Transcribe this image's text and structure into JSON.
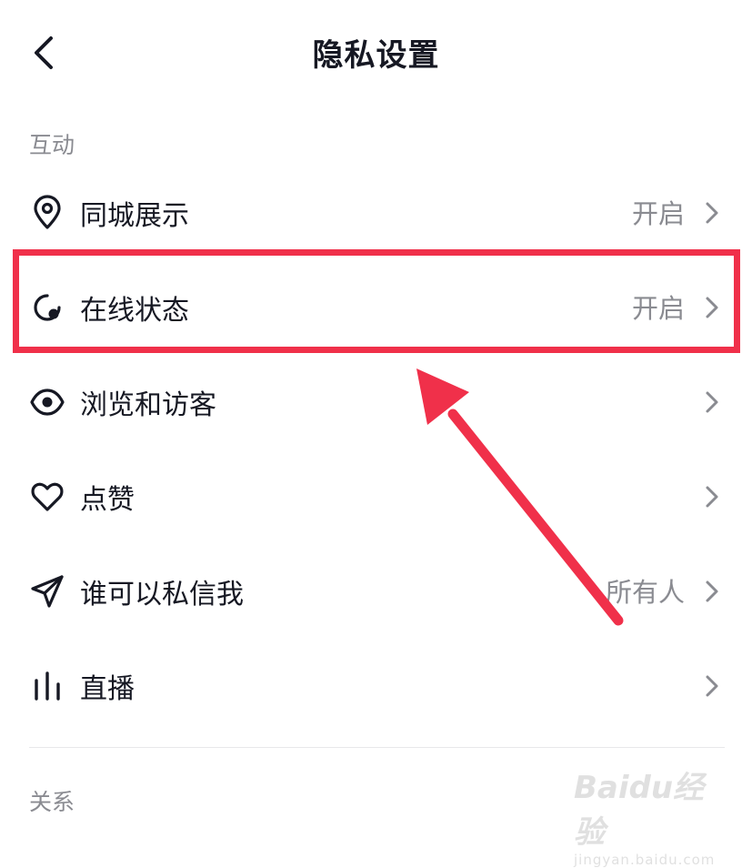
{
  "header": {
    "back_icon": "chevron-left-icon",
    "title": "隐私设置"
  },
  "sections": {
    "interaction_label": "互动",
    "relations_label": "关系"
  },
  "rows": [
    {
      "icon": "location-pin-icon",
      "label": "同城展示",
      "value": "开启"
    },
    {
      "icon": "online-status-icon",
      "label": "在线状态",
      "value": "开启"
    },
    {
      "icon": "eye-icon",
      "label": "浏览和访客",
      "value": ""
    },
    {
      "icon": "heart-icon",
      "label": "点赞",
      "value": ""
    },
    {
      "icon": "paper-plane-icon",
      "label": "谁可以私信我",
      "value": "所有人"
    },
    {
      "icon": "live-bars-icon",
      "label": "直播",
      "value": ""
    }
  ],
  "annotation": {
    "highlight_color": "#f0304a"
  },
  "watermark": {
    "main": "Baidu经验",
    "sub": "jingyan.baidu.com"
  },
  "colors": {
    "text_primary": "#161823",
    "text_secondary": "#8a8b91"
  }
}
